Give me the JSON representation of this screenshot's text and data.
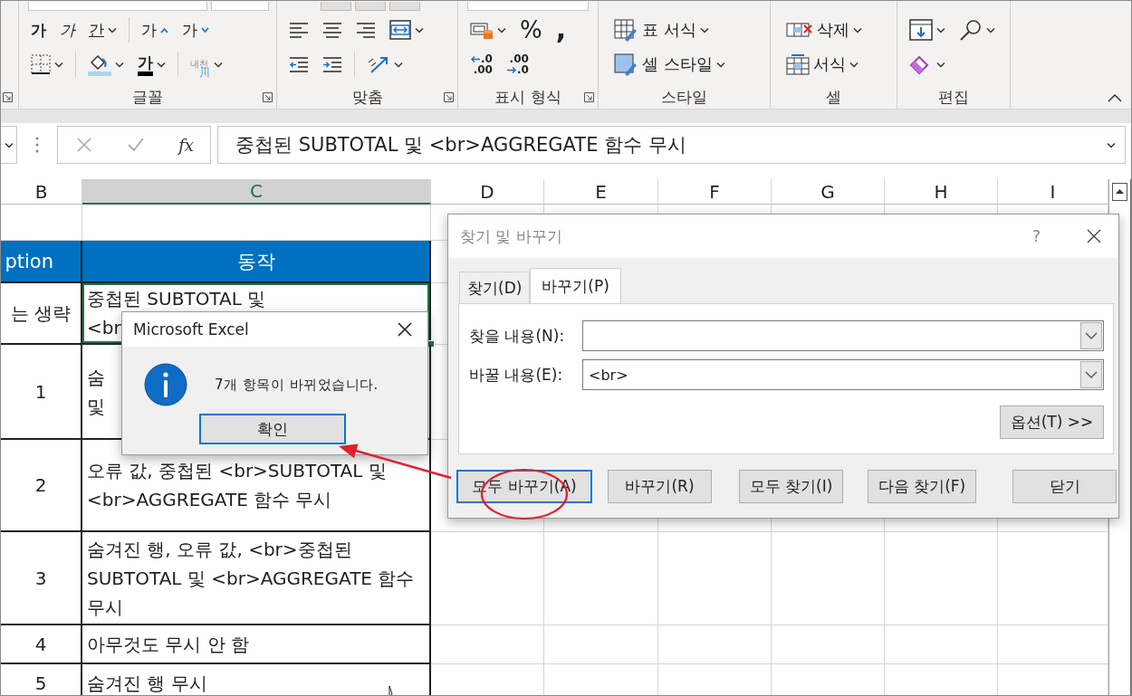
{
  "ribbon": {
    "groups": [
      {
        "launcher": true
      },
      {
        "label": "글꼴",
        "launcher": true,
        "top_controls": [
          {
            "kind": "field"
          },
          {
            "kind": "field"
          }
        ],
        "rows": [
          [
            {
              "kind": "bold",
              "text": "가"
            },
            {
              "kind": "italic",
              "text": "가"
            },
            {
              "kind": "underline",
              "text": "간",
              "caret": true
            },
            {
              "kind": "sep"
            },
            {
              "kind": "grow",
              "text": "가"
            },
            {
              "kind": "shrink",
              "text": "가"
            }
          ],
          [
            {
              "kind": "borders",
              "caret": true
            },
            {
              "kind": "sep"
            },
            {
              "kind": "fill",
              "caret": true
            },
            {
              "kind": "fontcolor",
              "text": "가",
              "caret": true
            },
            {
              "kind": "sep"
            },
            {
              "kind": "phonetic",
              "text": "내천",
              "sub": "川",
              "caret": true
            }
          ]
        ]
      },
      {
        "label": "맞춤",
        "launcher": true,
        "top_controls": [
          {
            "kind": "button"
          },
          {
            "kind": "button"
          },
          {
            "kind": "button"
          }
        ],
        "rows": [
          [
            {
              "kind": "align_left"
            },
            {
              "kind": "align_center"
            },
            {
              "kind": "align_right"
            },
            {
              "kind": "merge",
              "caret": true
            }
          ],
          [
            {
              "kind": "outdent"
            },
            {
              "kind": "indent"
            },
            {
              "kind": "sep"
            },
            {
              "kind": "orientation",
              "caret": true
            }
          ]
        ]
      },
      {
        "label": "표시 형식",
        "launcher": true,
        "top_controls": [
          {
            "kind": "field"
          }
        ],
        "rows": [
          [
            {
              "kind": "accounting",
              "caret": true
            },
            {
              "kind": "percent",
              "text": "%"
            },
            {
              "kind": "comma",
              "text": ","
            }
          ],
          [
            {
              "kind": "decimal_more",
              "lines": [
                ".0",
                ".00"
              ]
            },
            {
              "kind": "decimal_less",
              "lines": [
                ".00",
                ".0"
              ]
            }
          ]
        ]
      },
      {
        "label": "스타일",
        "rows": [
          [
            {
              "kind": "table_format",
              "text": "표 서식",
              "caret": true
            }
          ],
          [
            {
              "kind": "cell_style",
              "text": "셀 스타일",
              "caret": true
            }
          ]
        ]
      },
      {
        "label": "셀",
        "rows": [
          [
            {
              "kind": "delete",
              "text": "삭제",
              "caret": true
            }
          ],
          [
            {
              "kind": "format",
              "text": "서식",
              "caret": true
            }
          ]
        ]
      },
      {
        "label": "편집",
        "rows": [
          [
            {
              "kind": "fill_down",
              "caret": true
            },
            {
              "kind": "find",
              "caret": true
            }
          ],
          [
            {
              "kind": "clear",
              "caret": true
            }
          ]
        ]
      },
      {
        "collapse": true
      }
    ]
  },
  "formula_bar": {
    "insert_function": "fx",
    "value": "중첩된 SUBTOTAL 및 <br>AGGREGATE 함수 무시"
  },
  "sheet": {
    "columns": [
      {
        "label": "B",
        "selected": false
      },
      {
        "label": "C",
        "selected": true
      },
      {
        "label": "D",
        "selected": false
      },
      {
        "label": "E",
        "selected": false
      },
      {
        "label": "F",
        "selected": false
      },
      {
        "label": "G",
        "selected": false
      },
      {
        "label": "H",
        "selected": false
      },
      {
        "label": "I",
        "selected": false
      }
    ],
    "rows": [
      {
        "kind": "blank"
      },
      {
        "kind": "header",
        "cells": [
          "ption",
          "동작"
        ]
      },
      {
        "kind": "data",
        "selected": true,
        "cells": [
          "는 생략",
          "중첩된 SUBTOTAL 및\n<br"
        ]
      },
      {
        "kind": "data",
        "selected": false,
        "cells": [
          "1",
          "숨\n및"
        ]
      },
      {
        "kind": "data",
        "selected": false,
        "cells": [
          "2",
          "오류 값, 중첩된 <br>SUBTOTAL 및\n<br>AGGREGATE 함수 무시"
        ]
      },
      {
        "kind": "data",
        "selected": false,
        "cells": [
          "3",
          "숨겨진 행, 오류 값, <br>중첩된 SUBTOTAL 및 <br>AGGREGATE 함수 무시"
        ]
      },
      {
        "kind": "data",
        "selected": false,
        "cells": [
          "4",
          "아무것도 무시 안 함"
        ]
      },
      {
        "kind": "data",
        "selected": false,
        "cells": [
          "5",
          "숨겨진 행 무시"
        ]
      }
    ]
  },
  "find_dialog": {
    "title": "찾기 및 바꾸기",
    "active": false,
    "help": "?",
    "tabs": [
      {
        "label": "찾기(D)",
        "selected": false
      },
      {
        "label": "바꾸기(P)",
        "selected": true
      }
    ],
    "fields": [
      {
        "label": "찾을 내용(N):"
      },
      {
        "label": "바꿀 내용(E):",
        "value": "<br>"
      }
    ],
    "options_button": "옵션(T) >>",
    "buttons": [
      {
        "label": "모두 바꾸기(A)",
        "focused": true
      },
      {
        "label": "바꾸기(R)",
        "focused": false
      },
      {
        "label": "모두 찾기(I)",
        "focused": false
      },
      {
        "label": "다음 찾기(F)",
        "focused": false
      },
      {
        "label": "닫기",
        "focused": false
      }
    ]
  },
  "message_box": {
    "title": "Microsoft Excel",
    "active": true,
    "message": "7개 항목이 바뀌었습니다.",
    "buttons": [
      {
        "label": "확인",
        "focused": true
      }
    ]
  },
  "annotations": [
    {
      "kind": "arrow"
    },
    {
      "kind": "ellipse"
    },
    {
      "kind": "cursor"
    }
  ]
}
